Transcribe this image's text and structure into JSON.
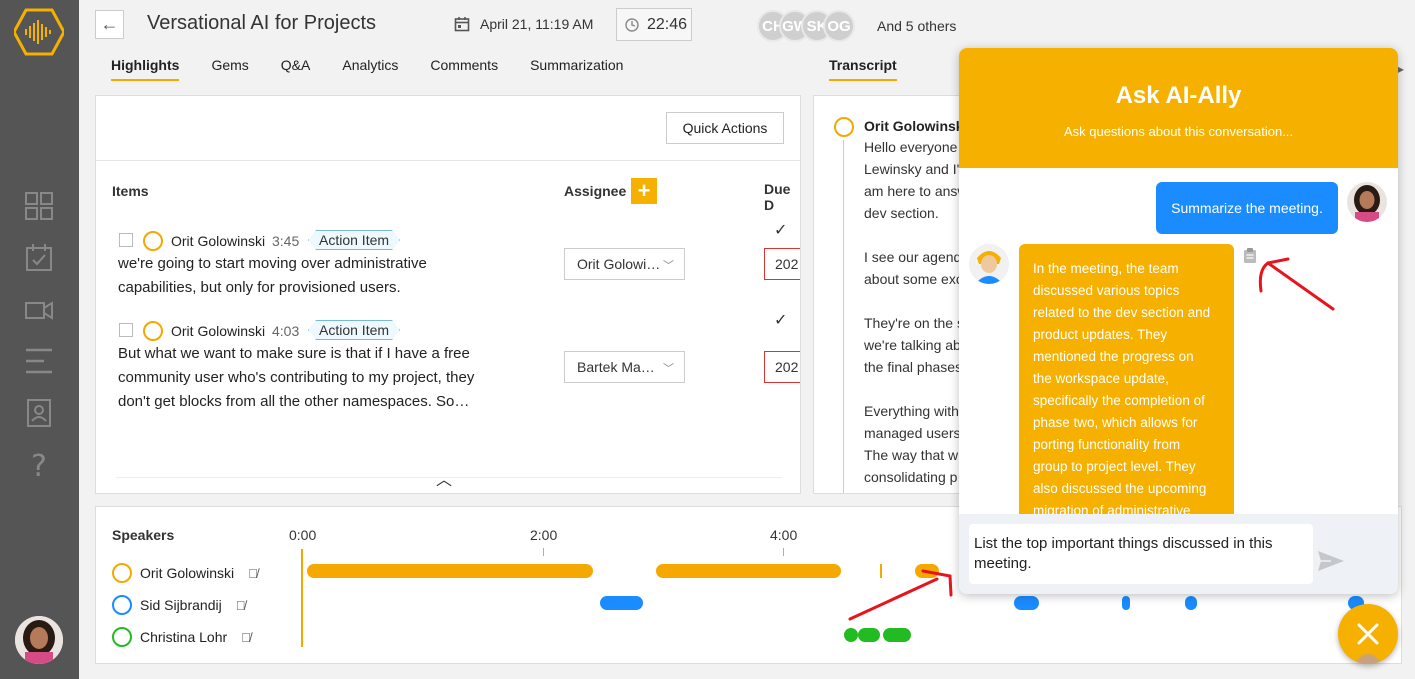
{
  "header": {
    "title": "Versational AI for Projects",
    "date": "April 21, 11:19 AM",
    "duration": "22:46",
    "participants": [
      "CH",
      "GW",
      "SK",
      "OG"
    ],
    "others": "And 5 others"
  },
  "tabs": [
    "Highlights",
    "Gems",
    "Q&A",
    "Analytics",
    "Comments",
    "Summarization"
  ],
  "active_tab": "Highlights",
  "transcript_tab": "Transcript",
  "highlights": {
    "quick_actions": "Quick Actions",
    "col_items": "Items",
    "col_assignee": "Assignee",
    "col_due": "Due D",
    "items": [
      {
        "speaker": "Orit Golowinski",
        "time": "3:45",
        "tag": "Action Item",
        "lines": [
          "we're going to start moving over administrative",
          "capabilities, but only for provisioned users."
        ],
        "assignee": "Orit Golowi…",
        "due": "202"
      },
      {
        "speaker": "Orit Golowinski",
        "time": "4:03",
        "tag": "Action Item",
        "lines": [
          "But what we want to make sure is that if I have a free",
          "community user who's contributing to my project, they",
          "don't get blocks from all the other namespaces. So…"
        ],
        "assignee": "Bartek Ma…",
        "due": "202"
      }
    ]
  },
  "transcript": {
    "speaker": "Orit Golowinski",
    "paragraphs": [
      [
        "Hello everyone",
        "Lewinsky and I'",
        "am here to answ",
        "dev section."
      ],
      [
        "I see our agend",
        "about some exc"
      ],
      [
        "They're on the s",
        "we're talking ab",
        "the final phases"
      ],
      [
        "Everything with",
        "managed users",
        "The way that w",
        "consolidating p"
      ]
    ]
  },
  "timeline": {
    "label": "Speakers",
    "ticks": [
      "0:00",
      "2:00",
      "4:00"
    ],
    "speakers": [
      {
        "name": "Orit Golowinski",
        "color": "#f5a800"
      },
      {
        "name": "Sid Sijbrandij",
        "color": "#1a8cff"
      },
      {
        "name": "Christina Lohr",
        "color": "#22bb22"
      }
    ]
  },
  "chat": {
    "title": "Ask AI-Ally",
    "subtitle": "Ask questions about this conversation...",
    "user_message": "Summarize the meeting.",
    "bot_lines": [
      "In the meeting, the team",
      "discussed various topics",
      "related to the dev section and",
      "product updates. They",
      "mentioned the progress on",
      "the workspace update,",
      "specifically the completion of",
      "phase two, which allows for",
      "porting functionality from",
      "group to project level. They",
      "also discussed the upcoming",
      "migration of administrative"
    ],
    "input_value": "List the top important things discussed in this meeting."
  },
  "colors": {
    "accent": "#f5b000",
    "blue": "#1a8cff",
    "green": "#22bb22"
  }
}
